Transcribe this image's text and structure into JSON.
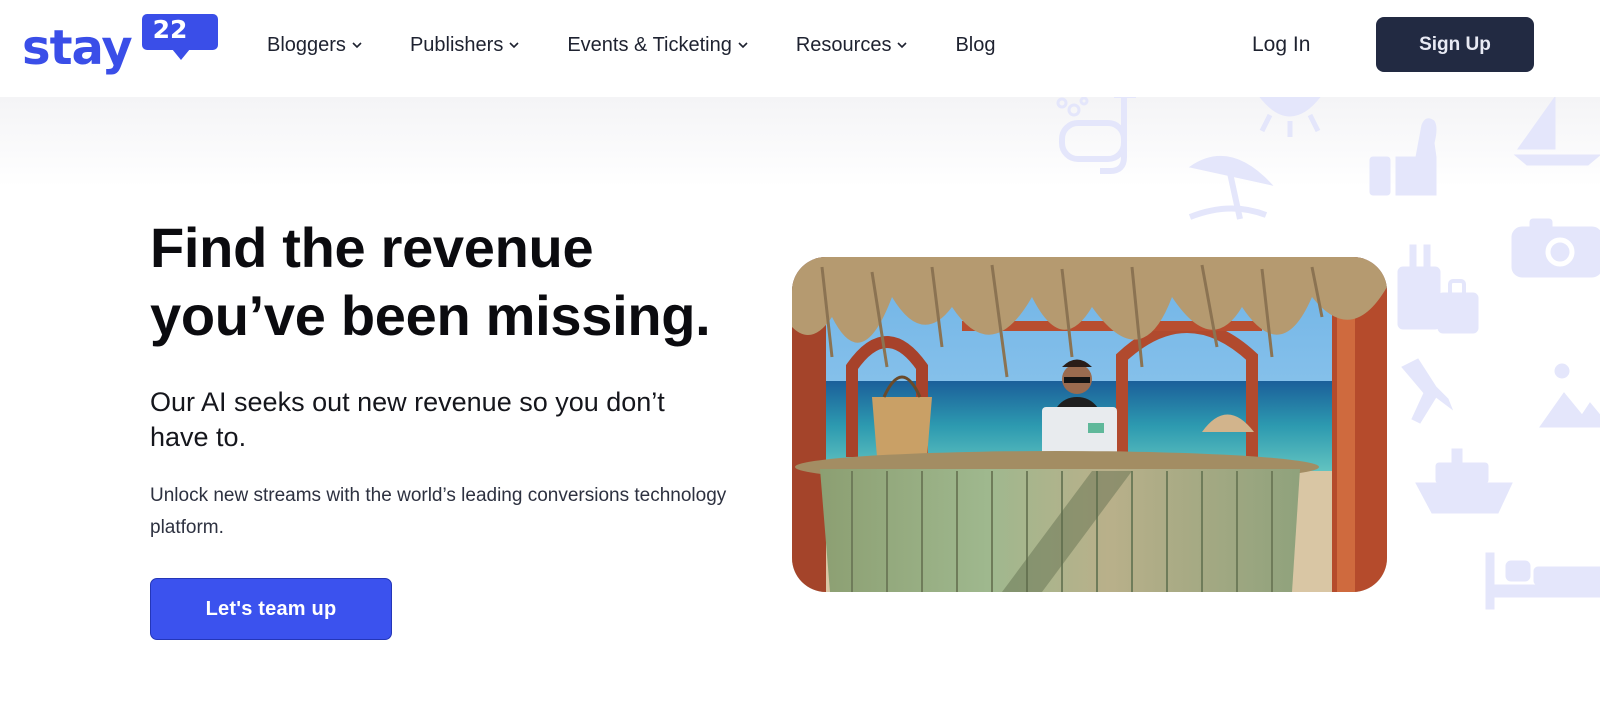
{
  "brand": {
    "logo_word": "stay",
    "logo_number": "22",
    "accent_color": "#3a4ee8"
  },
  "nav": {
    "items": [
      {
        "label": "Bloggers",
        "has_dropdown": true
      },
      {
        "label": "Publishers",
        "has_dropdown": true
      },
      {
        "label": "Events & Ticketing",
        "has_dropdown": true
      },
      {
        "label": "Resources",
        "has_dropdown": true
      },
      {
        "label": "Blog",
        "has_dropdown": false
      }
    ],
    "login_label": "Log In",
    "signup_label": "Sign Up",
    "signup_color": "#222a42"
  },
  "hero": {
    "headline_line1": "Find the revenue",
    "headline_line2": "you’ve been missing.",
    "subheadline": "Our AI seeks out new revenue so you don’t have to.",
    "body": "Unlock new streams with the world’s leading conversions technology platform.",
    "cta_label": "Let's team up",
    "cta_color": "#3b52ee",
    "image_icon": "beach-bar-laptop-photo",
    "background_icons": [
      "bubbles-icon",
      "snorkel-mask-icon",
      "sun-icon",
      "sailboat-icon",
      "thumbs-up-icon",
      "beach-umbrella-icon",
      "camera-icon",
      "luggage-icon",
      "airplane-icon",
      "mountain-icon",
      "cruise-ship-icon",
      "bed-icon"
    ]
  }
}
